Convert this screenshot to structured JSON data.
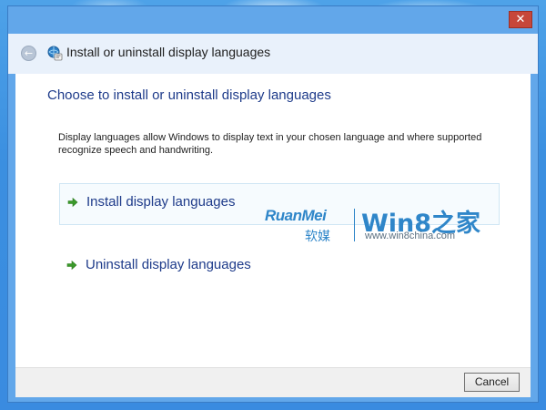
{
  "window": {
    "title": "Install or uninstall display languages",
    "close_glyph": "✕",
    "back_glyph": "←",
    "title_icon": "control-panel-language-icon"
  },
  "main": {
    "heading": "Choose to install or uninstall display languages",
    "description": "Display languages allow Windows to display text in your chosen language and where supported recognize speech and handwriting.",
    "options": [
      {
        "label": "Install display languages",
        "icon": "green-arrow-icon",
        "highlighted": true
      },
      {
        "label": "Uninstall display languages",
        "icon": "green-arrow-icon",
        "highlighted": false
      }
    ]
  },
  "watermark": {
    "brand_latin": "RuanMei",
    "brand_cn": "软媒",
    "site_name": "Win8之家",
    "site_url": "www.win8china.com"
  },
  "footer": {
    "cancel_label": "Cancel"
  },
  "colors": {
    "accent_link": "#1e3b8a",
    "window_frame": "#62a7ea",
    "close_button": "#c7473a",
    "arrow_green": "#3a9a2a",
    "watermark_blue": "#2f86c9"
  }
}
